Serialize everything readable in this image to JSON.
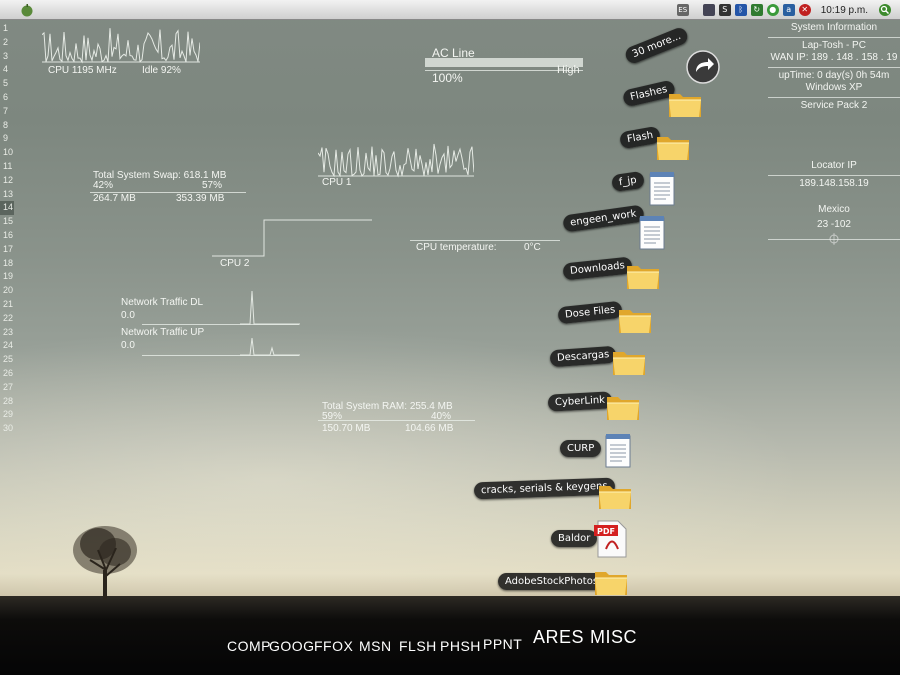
{
  "topbar": {
    "clock": "10:19 p.m.",
    "tray_lang": "ES"
  },
  "line_numbers": [
    "1",
    "2",
    "3",
    "4",
    "5",
    "6",
    "7",
    "8",
    "9",
    "10",
    "11",
    "12",
    "13",
    "14",
    "15",
    "16",
    "17",
    "18",
    "19",
    "20",
    "21",
    "22",
    "23",
    "24",
    "25",
    "26",
    "27",
    "28",
    "29",
    "30"
  ],
  "active_line": "14",
  "cpu": {
    "freq": "CPU 1195 MHz",
    "idle": "Idle 92%"
  },
  "swap": {
    "title": "Total System Swap:",
    "total": "618.1 MB",
    "used_pct": "42%",
    "free_pct": "57%",
    "used": "264.7 MB",
    "free": "353.39 MB"
  },
  "cpu1": {
    "label": "CPU 1"
  },
  "cpu2": {
    "label": "CPU 2"
  },
  "battery": {
    "source": "AC Line",
    "level": "High",
    "percent": "100%"
  },
  "temperature": {
    "label": "CPU temperature:",
    "value": "0°C"
  },
  "network": {
    "dl_label": "Network Traffic DL",
    "dl_value": "0.0",
    "up_label": "Network Traffic UP",
    "up_value": "0.0"
  },
  "ram": {
    "title": "Total System RAM:",
    "total": "255.4 MB",
    "used_pct": "59%",
    "free_pct": "40%",
    "used": "150.70 MB",
    "free": "104.66 MB"
  },
  "sysinfo": {
    "title": "System Information",
    "host": "Lap-Tosh - PC",
    "wan_ip": "WAN IP: 189 . 148 . 158 . 19",
    "uptime": "upTime: 0 day(s) 0h 54m",
    "os": "Windows XP",
    "sp": "Service Pack 2",
    "locator_title": "Locator IP",
    "locator_ip": "189.148.158.19",
    "country": "Mexico",
    "coords": "23 -102"
  },
  "desktop_items": [
    {
      "label": "30 more...",
      "icon": "arrow-circle-icon"
    },
    {
      "label": "Flashes",
      "icon": "folder-icon"
    },
    {
      "label": "Flash",
      "icon": "folder-icon"
    },
    {
      "label": "f_jp",
      "icon": "notepad-icon"
    },
    {
      "label": "engeen_work",
      "icon": "notepad-icon"
    },
    {
      "label": "Downloads",
      "icon": "folder-icon"
    },
    {
      "label": "Dose Files",
      "icon": "folder-icon"
    },
    {
      "label": "Descargas",
      "icon": "folder-icon"
    },
    {
      "label": "CyberLink",
      "icon": "folder-icon"
    },
    {
      "label": "CURP",
      "icon": "notepad-icon"
    },
    {
      "label": "cracks, serials & keygens",
      "icon": "folder-icon"
    },
    {
      "label": "Baldor",
      "icon": "pdf-icon"
    },
    {
      "label": "AdobeStockPhotos",
      "icon": "folder-icon"
    }
  ],
  "dock": [
    "COMP",
    "GOOG",
    "FFOX",
    "MSN",
    "FLSH",
    "PHSH",
    "PPNT",
    "ARES",
    "MISC"
  ]
}
